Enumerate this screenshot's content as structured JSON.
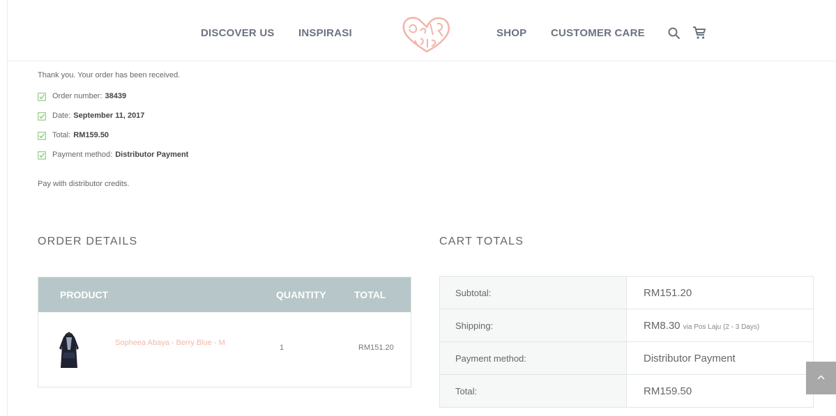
{
  "nav": {
    "discover": "DISCOVER US",
    "inspirasi": "INSPIRASI",
    "shop": "SHOP",
    "customer_care": "CUSTOMER CARE",
    "icons": [
      "search-icon",
      "cart-icon"
    ]
  },
  "colors": {
    "nav_text": "#6b7280",
    "logo": "#f2b4a8",
    "table_header": "#b7c6c8",
    "product_link": "#f0b9a8",
    "check": "#7cc36b",
    "scroll_button": "#a8a8a8"
  },
  "order_received": {
    "message": "Thank you. Your order has been received.",
    "overview": [
      {
        "label": "Order number:",
        "value": "38439"
      },
      {
        "label": "Date:",
        "value": "September 11, 2017"
      },
      {
        "label": "Total:",
        "value": "RM159.50"
      },
      {
        "label": "Payment method:",
        "value": "Distributor Payment"
      }
    ],
    "payment_note": "Pay with distributor credits."
  },
  "order_details": {
    "title": "ORDER DETAILS",
    "headers": {
      "product": "PRODUCT",
      "quantity": "QUANTITY",
      "total": "TOTAL"
    },
    "items": [
      {
        "name": "Sopheea Abaya - Berry Blue - M",
        "quantity": "1",
        "total": "RM151.20"
      }
    ]
  },
  "cart_totals": {
    "title": "CART TOTALS",
    "rows": [
      {
        "label": "Subtotal:",
        "value": "RM151.20",
        "note": ""
      },
      {
        "label": "Shipping:",
        "value": "RM8.30",
        "note": "via Pos Laju (2 - 3 Days)"
      },
      {
        "label": "Payment method:",
        "value": "Distributor Payment",
        "note": ""
      },
      {
        "label": "Total:",
        "value": "RM159.50",
        "note": ""
      }
    ]
  }
}
